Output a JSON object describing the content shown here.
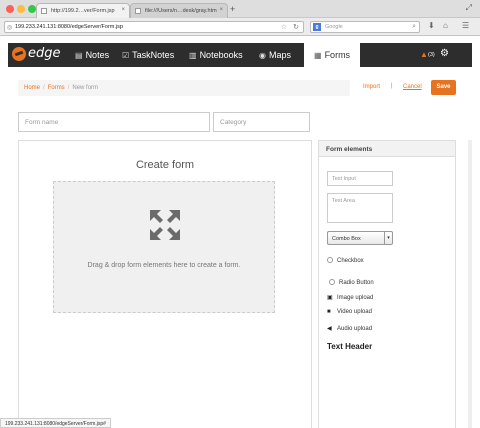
{
  "browser": {
    "tabs": [
      {
        "title": "http://199.2…ver/Form.jsp"
      },
      {
        "title": "file:///Users/n…desk/gray.htm"
      }
    ],
    "url": "199.233.241.131:8080/edgeServer/Form.jsp",
    "search_placeholder": "Google",
    "status_url": "199.233.241.131:8080/edgeServer/Form.jsp#"
  },
  "nav": {
    "brand": "edge",
    "items": [
      {
        "label": "Notes",
        "icon": "notes-icon"
      },
      {
        "label": "TaskNotes",
        "icon": "tasknotes-icon"
      },
      {
        "label": "Notebooks",
        "icon": "notebooks-icon"
      },
      {
        "label": "Maps",
        "icon": "globe-icon"
      },
      {
        "label": "Forms",
        "icon": "forms-icon",
        "active": true
      }
    ],
    "alert_count": "(3)"
  },
  "breadcrumb": [
    "Home",
    "Forms",
    "New form"
  ],
  "actions": {
    "import": "Import",
    "separator": "|",
    "cancel": "Cancel",
    "save": "Save"
  },
  "form": {
    "name_placeholder": "Form name",
    "category_placeholder": "Category"
  },
  "canvas": {
    "title": "Create form",
    "drop_hint": "Drag & drop form elements here to create a form."
  },
  "elements": {
    "header": "Form elements",
    "text_input": "Text Input",
    "text_area": "Text Area",
    "combo_box": "Combo Box",
    "checkbox": "Checkbox",
    "radio": "Radio Button",
    "image_upload": "Image upload",
    "video_upload": "Video upload",
    "audio_upload": "Audio upload",
    "text_header": "Text Header"
  },
  "colors": {
    "accent": "#e8731f",
    "nav_bg": "#2d2d2d"
  }
}
